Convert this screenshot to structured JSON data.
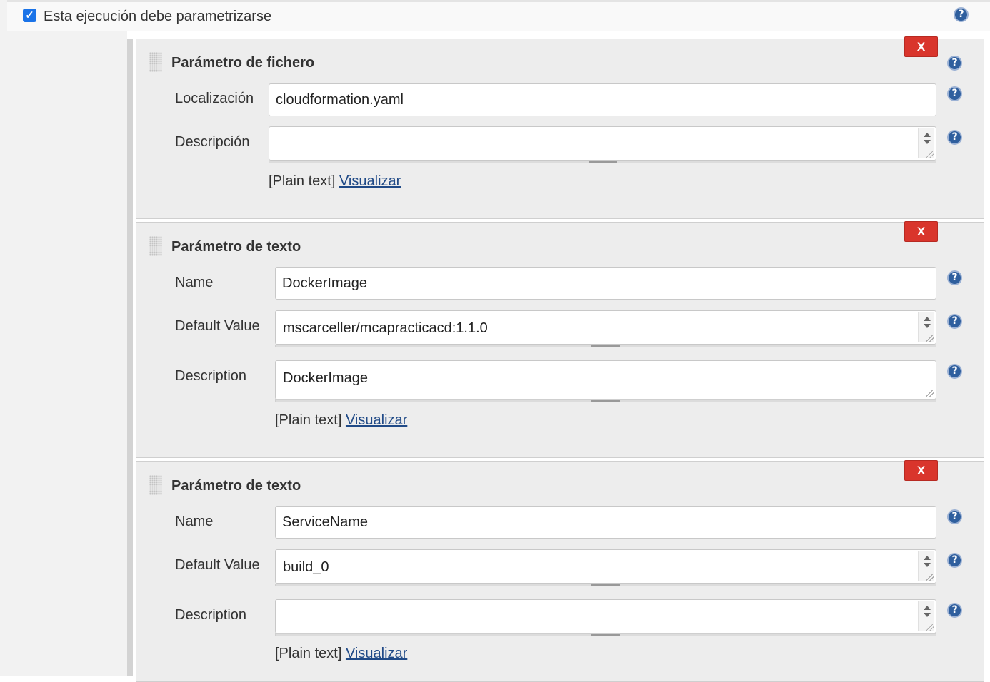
{
  "parametrize": {
    "checked": true,
    "label": "Esta ejecución debe parametrizarse"
  },
  "blocks": [
    {
      "title": "Parámetro de fichero",
      "delete_label": "X",
      "fields": [
        {
          "label": "Localización",
          "value": "cloudformation.yaml"
        },
        {
          "label": "Descripción",
          "value": ""
        }
      ],
      "format_label": "[Plain text]",
      "preview_link": "Visualizar"
    },
    {
      "title": "Parámetro de texto",
      "delete_label": "X",
      "fields": [
        {
          "label": "Name",
          "value": "DockerImage"
        },
        {
          "label": "Default Value",
          "value": "mscarceller/mcapracticacd:1.1.0"
        },
        {
          "label": "Description",
          "value": "DockerImage"
        }
      ],
      "format_label": "[Plain text]",
      "preview_link": "Visualizar"
    },
    {
      "title": "Parámetro de texto",
      "delete_label": "X",
      "fields": [
        {
          "label": "Name",
          "value": "ServiceName"
        },
        {
          "label": "Default Value",
          "value": "build_0"
        },
        {
          "label": "Description",
          "value": ""
        }
      ],
      "format_label": "[Plain text]",
      "preview_link": "Visualizar"
    }
  ],
  "help_glyph": "?",
  "icons": {
    "help": "help-icon",
    "drag": "drag-handle-icon",
    "delete": "delete-button"
  },
  "colors": {
    "delete_button": "#d9352c",
    "help_icon": "#2f5f9e",
    "link": "#204a87",
    "checkbox": "#1a73e8"
  }
}
